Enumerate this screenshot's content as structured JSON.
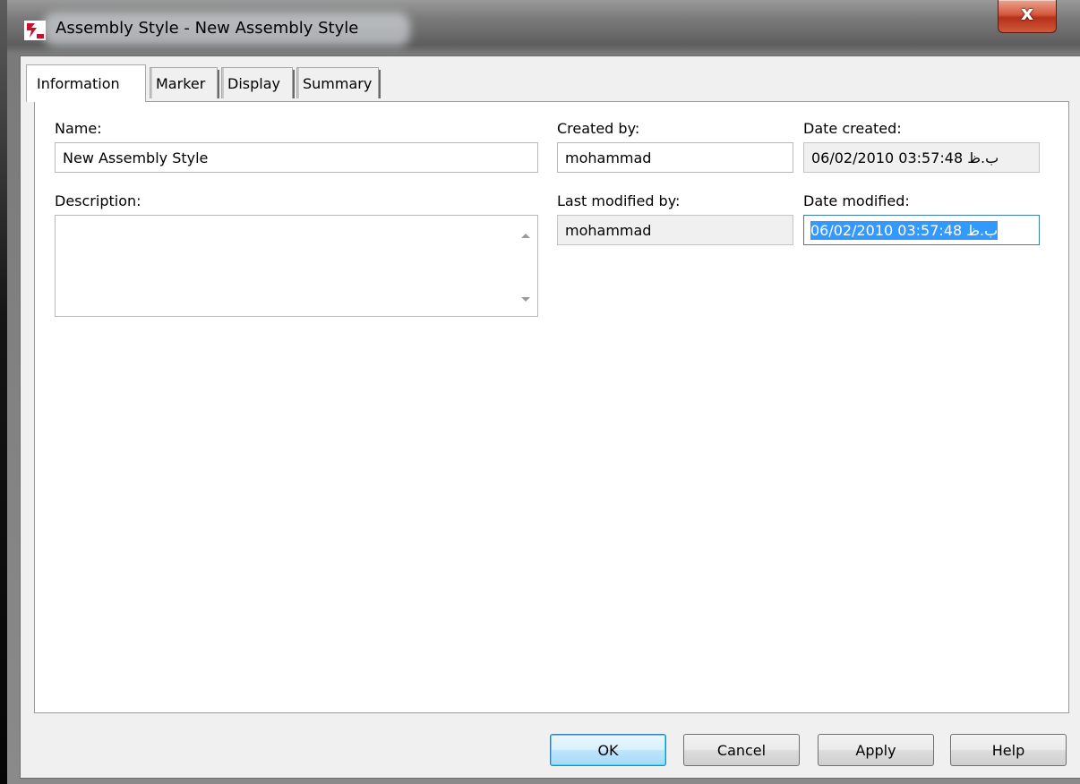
{
  "window": {
    "title": "Assembly Style - New Assembly Style",
    "close_glyph": "x"
  },
  "tabs": [
    {
      "label": "Information",
      "active": true
    },
    {
      "label": "Marker",
      "active": false
    },
    {
      "label": "Display",
      "active": false
    },
    {
      "label": "Summary",
      "active": false
    }
  ],
  "form": {
    "name_label": "Name:",
    "name_value": "New Assembly Style",
    "description_label": "Description:",
    "description_value": "",
    "created_by_label": "Created by:",
    "created_by_value": "mohammad",
    "date_created_label": "Date created:",
    "date_created_value": "06/02/2010 03:57:48 ب.ظ",
    "last_modified_by_label": "Last modified by:",
    "last_modified_by_value": "mohammad",
    "date_modified_label": "Date modified:",
    "date_modified_value": "06/02/2010 03:57:48 ب.ظ"
  },
  "buttons": {
    "ok": "OK",
    "cancel": "Cancel",
    "apply": "Apply",
    "help": "Help"
  },
  "colors": {
    "selection": "#3399ff",
    "focus_border": "#3c7fb1",
    "close_button": "#c7452a"
  }
}
